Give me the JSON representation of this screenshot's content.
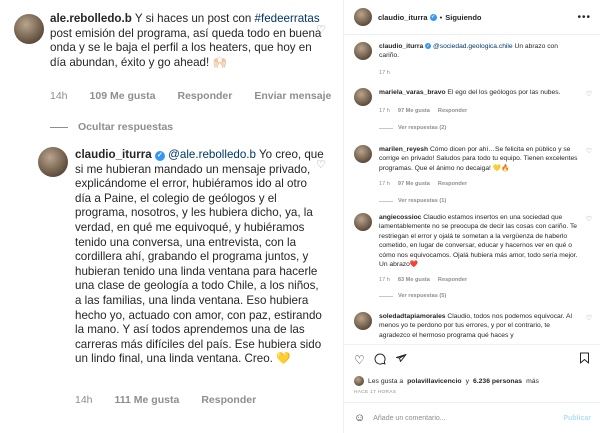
{
  "left": {
    "comment1": {
      "username": "ale.rebolledo.b",
      "text_a": "Y si haces un post con",
      "hashtag": "#fedeerratas",
      "text_b": "post emisión del programa, así queda todo en buena onda y se le baja el perfil a los heaters, que hoy en día abundan, éxito y go ahead! 🙌🏻",
      "time": "14h",
      "likes": "109 Me gusta",
      "reply": "Responder",
      "send": "Enviar mensaje"
    },
    "hide_replies": "Ocultar respuestas",
    "comment2": {
      "username": "claudio_iturra",
      "mention": "@ale.rebolledo.b",
      "text": "Yo creo, que si me hubieran mandado un mensaje privado, explicándome el error, hubiéramos ido al otro día a Paine, el colegio de geólogos y el programa, nosotros, y les hubiera dicho, ya, la verdad, en qué me equivoqué, y hubiéramos tenido una conversa, una entrevista, con la cordillera ahí, grabando el programa juntos, y hubieran tenido una linda ventana para hacerle una clase de geología a todo Chile, a los niños, a las familias, una linda ventana. Eso hubiera hecho yo, actuado con amor, con paz, estirando la mano. Y así todos aprendemos una de las carreras más difíciles del país. Ese hubiera sido un lindo final, una linda ventana. Creo. 💛",
      "time": "14h",
      "likes": "111 Me gusta",
      "reply": "Responder"
    }
  },
  "right": {
    "header": {
      "username": "claudio_iturra",
      "dot": "•",
      "follow": "Siguiendo",
      "more": "•••"
    },
    "caption": {
      "username": "claudio_iturra",
      "mention": "@sociedad.geologica.chile",
      "text": "Un abrazo con cariño.",
      "time": "17 h"
    },
    "comments": [
      {
        "username": "mariela_varas_bravo",
        "text": "El ego del los geólogos por las nubes.",
        "time": "17 h",
        "likes": "97 Me gusta",
        "reply": "Responder",
        "replies": "Ver respuestas (2)"
      },
      {
        "username": "marilen_reyesh",
        "text": "Cómo dicen por ahí…Se felicita en público y se corrige en privado! Saludos para todo tu equipo. Tienen excelentes programas. Que el ánimo no decaiga! 💛🔥",
        "time": "17 h",
        "likes": "97 Me gusta",
        "reply": "Responder",
        "replies": "Ver respuestas (1)"
      },
      {
        "username": "angiecossioc",
        "text": "Claudio estamos insertos en una sociedad que lamentablemente no se preocupa de decir las cosas con cariño. Te restriegan el error y ojalá te sometan a la vergüenza de haberlo cometido, en lugar de conversar, educar y hacernos ver en qué o cómo nos equivocamos. Ojalá hubiera más amor, todo sería mejor. Un abrazo❤️",
        "time": "17 h",
        "likes": "83 Me gusta",
        "reply": "Responder",
        "replies": "Ver respuestas (5)"
      },
      {
        "username": "soledadtapiamorales",
        "text": "Claudio, todos nos podemos equivocar. Al menos yo te perdono por tus errores, y por el contrario, te agradezco el hermoso programa qué haces y",
        "time": "",
        "likes": "",
        "reply": "",
        "replies": ""
      }
    ],
    "likes": {
      "prefix": "Les gusta a",
      "user": "polavillavicencio",
      "mid": "y",
      "count": "6.236 personas",
      "suffix": "más"
    },
    "ago": "HACE 17 HORAS",
    "add_comment": {
      "placeholder": "Añade un comentario...",
      "publish": "Publicar"
    },
    "icons": [
      "heart-icon",
      "comment-icon",
      "share-icon",
      "bookmark-icon",
      "smile-icon"
    ]
  }
}
